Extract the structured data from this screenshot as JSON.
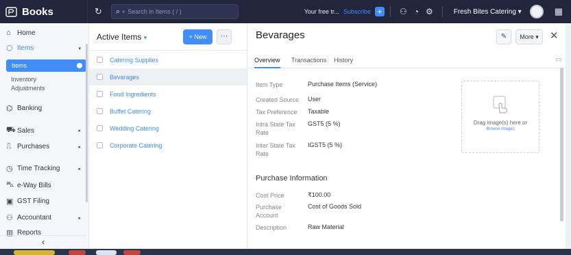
{
  "topbar": {
    "app_name": "Books",
    "search_placeholder": "Search in Items ( / )",
    "trial_text": "Your free tr...",
    "subscribe_label": "Subscribe",
    "org_name": "Fresh Bites Catering"
  },
  "sidebar": {
    "home": "Home",
    "items_group": "Items",
    "items_active": "Items",
    "inventory_adjustments": "Inventory Adjustments",
    "banking": "Banking",
    "sales": "Sales",
    "purchases": "Purchases",
    "time_tracking": "Time Tracking",
    "eway_bills": "e-Way Bills",
    "gst_filing": "GST Filing",
    "accountant": "Accountant",
    "reports": "Reports",
    "collapse_glyph": "‹"
  },
  "list": {
    "title": "Active Items",
    "new_label": "+ New",
    "more_glyph": "···",
    "items": [
      "Catering Supplies",
      "Bevarages",
      "Food Ingredients",
      "Buffet Catering",
      "Wedding Catering",
      "Corporate Catering"
    ]
  },
  "detail": {
    "title": "Bevarages",
    "more_label": "More",
    "tabs": [
      "Overview",
      "Transactions",
      "History"
    ],
    "fields": [
      {
        "label": "Item Type",
        "value": "Purchase Items (Service)"
      },
      {
        "label": "Created Source",
        "value": "User"
      },
      {
        "label": "Tax Preference",
        "value": "Taxable"
      },
      {
        "label": "Intra State Tax Rate",
        "value": "GST5 (5 %)"
      },
      {
        "label": "Inter State Tax Rate",
        "value": "IGST5 (5 %)"
      }
    ],
    "image_drop_text": "Drag image(s) here or",
    "browse_images": "Browse images",
    "purchase_section_title": "Purchase Information",
    "purchase_fields": [
      {
        "label": "Cost Price",
        "value": "₹100.00"
      },
      {
        "label": "Purchase Account",
        "value": "Cost of Goods Sold"
      },
      {
        "label": "Description",
        "value": "Raw Material"
      }
    ]
  },
  "colors": {
    "accent": "#408dfb",
    "topbar": "#21263c"
  }
}
